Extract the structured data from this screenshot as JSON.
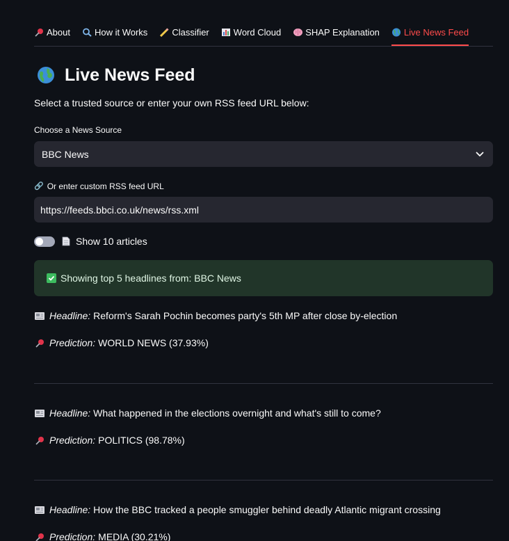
{
  "tabs": [
    {
      "label": "About",
      "icon": "pushpin-icon"
    },
    {
      "label": "How it Works",
      "icon": "magnifier-icon"
    },
    {
      "label": "Classifier",
      "icon": "pencil-icon"
    },
    {
      "label": "Word Cloud",
      "icon": "bar-chart-icon"
    },
    {
      "label": "SHAP Explanation",
      "icon": "brain-icon"
    },
    {
      "label": "Live News Feed",
      "icon": "globe-icon",
      "active": true
    }
  ],
  "title": "Live News Feed",
  "intro": "Select a trusted source or enter your own RSS feed URL below:",
  "source_label": "Choose a News Source",
  "source_value": "BBC News",
  "url_label": "Or enter custom RSS feed URL",
  "url_value": "https://feeds.bbci.co.uk/news/rss.xml",
  "toggle_label": "Show 10 articles",
  "toggle_on": false,
  "success_text": "Showing top 5 headlines from: BBC News",
  "headline_label": "Headline:",
  "prediction_label": "Prediction:",
  "articles": [
    {
      "headline": "Reform's Sarah Pochin becomes party's 5th MP after close by-election",
      "prediction": "WORLD NEWS (37.93%)"
    },
    {
      "headline": "What happened in the elections overnight and what's still to come?",
      "prediction": "POLITICS (98.78%)"
    },
    {
      "headline": "How the BBC tracked a people smuggler behind deadly Atlantic migrant crossing",
      "prediction": "MEDIA (30.21%)"
    }
  ],
  "colors": {
    "accent": "#ff4b4b",
    "background": "#0e1117",
    "success_bg": "#213529"
  }
}
